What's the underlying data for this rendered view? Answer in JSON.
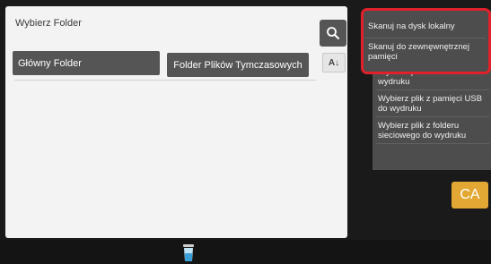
{
  "panel": {
    "title": "Wybierz Folder",
    "folders": [
      {
        "label": "Główny Folder"
      },
      {
        "label": "Folder Plików Tymczasowych"
      }
    ],
    "sort_label": "A↓"
  },
  "menu": {
    "items": [
      {
        "label": "Skanuj na dysk lokalny"
      },
      {
        "label": "Skanuj do zewnęwnętrznej pamięci"
      },
      {
        "label": "Wybierz plik z FTP do wydruku"
      },
      {
        "label": "Wybierz plik z pamięci USB do wydruku"
      },
      {
        "label": "Wybierz plik z folderu sieciowego do wydruku"
      }
    ]
  },
  "ca_label": "CA",
  "colors": {
    "highlight": "#e0212b",
    "ca": "#e3a833"
  },
  "icons": [
    "search-icon",
    "sort-icon",
    "trash-icon"
  ]
}
